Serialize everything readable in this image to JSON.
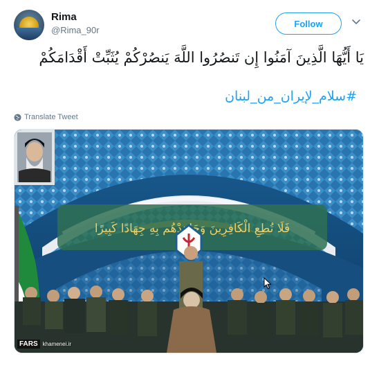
{
  "user": {
    "name": "Rima",
    "handle": "@Rima_90r"
  },
  "actions": {
    "follow_label": "Follow"
  },
  "tweet": {
    "text": "يَا أَيُّهَا الَّذِينَ آمَنُوا إِن تَنصُرُوا اللَّهَ يَنصُرْكُمْ يُثَبِّتْ أَقْدَامَكُمْ",
    "hashtag": "#سلام_لإيران_من_لبنان",
    "translate_label": "Translate Tweet"
  },
  "media": {
    "calligraphy": "فَلَا تُطِعِ الْكَافِرِينَ وَجَاهِدْهُم بِهِ جِهَادًا كَبِيرًا",
    "watermark_logo": "FARS",
    "watermark_site": "khamenei.ir"
  },
  "icons": {
    "caret": "chevron-down-icon",
    "globe": "globe-icon",
    "cursor": "mouse-pointer-icon"
  },
  "colors": {
    "accent": "#1da1f2",
    "text": "#14171a",
    "secondary": "#657786"
  }
}
